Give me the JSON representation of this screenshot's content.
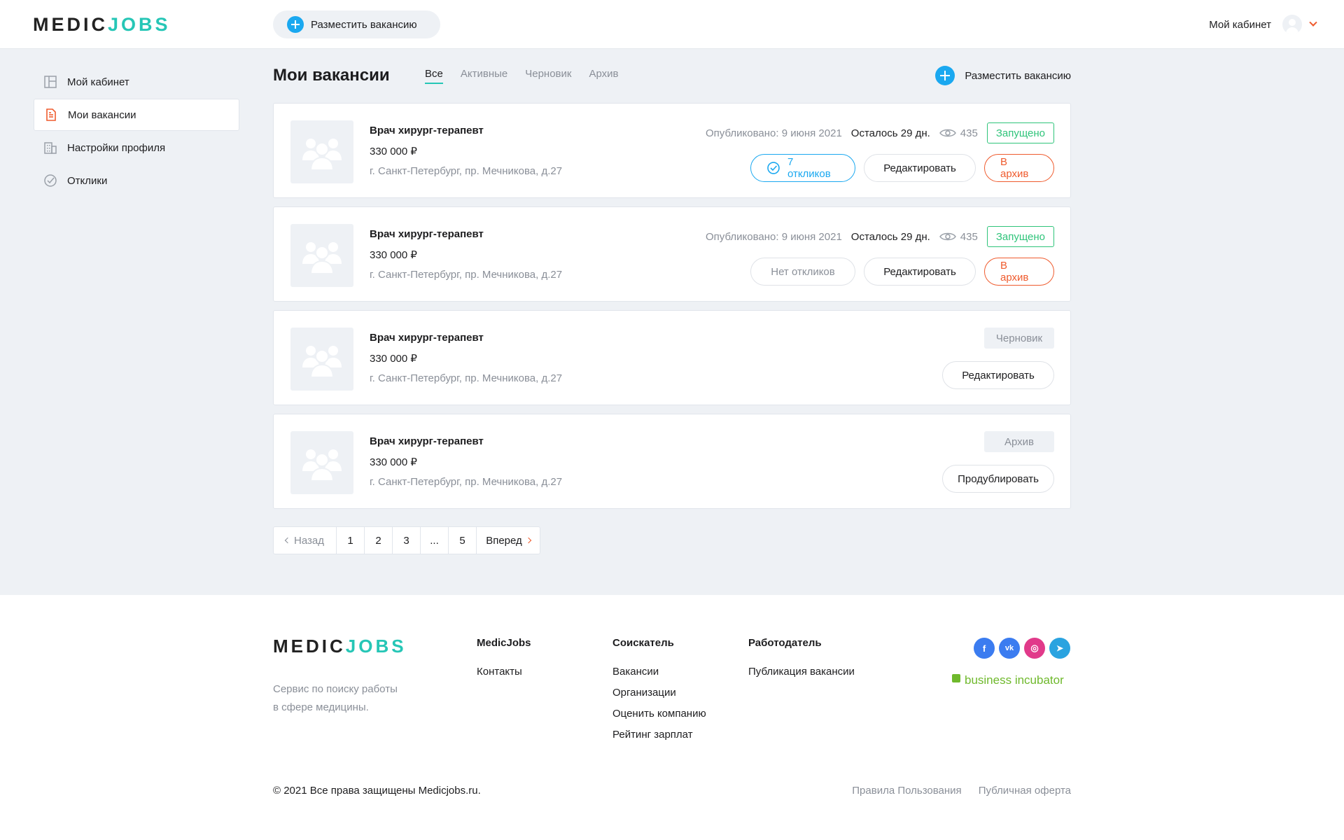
{
  "header": {
    "logo_part1": "MEDIC",
    "logo_part2": "JOBS",
    "post_vacancy_label": "Разместить вакансию",
    "cabinet_label": "Мой кабинет"
  },
  "sidebar": {
    "items": [
      {
        "label": "Мой кабинет",
        "icon": "dashboard-icon"
      },
      {
        "label": "Мои вакансии",
        "icon": "document-icon"
      },
      {
        "label": "Настройки профиля",
        "icon": "building-icon"
      },
      {
        "label": "Отклики",
        "icon": "check-circle-icon"
      }
    ]
  },
  "main": {
    "title": "Мои вакансии",
    "tabs": [
      "Все",
      "Активные",
      "Черновик",
      "Архив"
    ],
    "post_vacancy_label": "Разместить вакансию",
    "vacancies": [
      {
        "title": "Врач хирург-терапевт",
        "salary": "330 000 ₽",
        "address": "г. Санкт-Петербург, пр. Мечникова, д.27",
        "published": "Опубликовано: 9 июня 2021",
        "remaining": "Осталось 29 дн.",
        "views": "435",
        "status": "Запущено",
        "responses": "7 откликов",
        "edit": "Редактировать",
        "archive": "В архив"
      },
      {
        "title": "Врач хирург-терапевт",
        "salary": "330 000 ₽",
        "address": "г. Санкт-Петербург, пр. Мечникова, д.27",
        "published": "Опубликовано: 9 июня 2021",
        "remaining": "Осталось 29 дн.",
        "views": "435",
        "status": "Запущено",
        "responses": "Нет откликов",
        "edit": "Редактировать",
        "archive": "В архив"
      },
      {
        "title": "Врач хирург-терапевт",
        "salary": "330 000 ₽",
        "address": "г. Санкт-Петербург, пр. Мечникова, д.27",
        "status": "Черновик",
        "action": "Редактировать"
      },
      {
        "title": "Врач хирург-терапевт",
        "salary": "330 000 ₽",
        "address": "г. Санкт-Петербург, пр. Мечникова, д.27",
        "status": "Архив",
        "action": "Продублировать"
      }
    ],
    "pagination": {
      "prev": "Назад",
      "pages": [
        "1",
        "2",
        "3",
        "...",
        "5"
      ],
      "next": "Вперед"
    }
  },
  "footer": {
    "logo_part1": "MEDIC",
    "logo_part2": "JOBS",
    "tagline_line1": "Сервис по поиску работы",
    "tagline_line2": "в сфере медицины.",
    "columns": [
      {
        "heading": "MedicJobs",
        "links": [
          "Контакты"
        ]
      },
      {
        "heading": "Соискатель",
        "links": [
          "Вакансии",
          "Организации",
          "Оценить компанию",
          "Рейтинг зарплат"
        ]
      },
      {
        "heading": "Работодатель",
        "links": [
          "Публикация вакансии"
        ]
      }
    ],
    "socials": [
      {
        "icon": "facebook-icon",
        "glyph": "f",
        "color": "#3b7cf0"
      },
      {
        "icon": "vk-icon",
        "glyph": "vk",
        "color": "#3b7cf0"
      },
      {
        "icon": "instagram-icon",
        "glyph": "◎",
        "color": "#e13a8a"
      },
      {
        "icon": "telegram-icon",
        "glyph": "➤",
        "color": "#2aa3e0"
      }
    ],
    "partner": "business incubator",
    "copyright": "© 2021 Все права защищены Medicjobs.ru.",
    "links": [
      "Правила Пользования",
      "Публичная оферта"
    ]
  },
  "colors": {
    "accent_teal": "#26c6b6",
    "accent_blue": "#1aa8f0",
    "accent_orange": "#ef5b2e",
    "status_green": "#2fc47a",
    "background": "#eef1f5"
  }
}
